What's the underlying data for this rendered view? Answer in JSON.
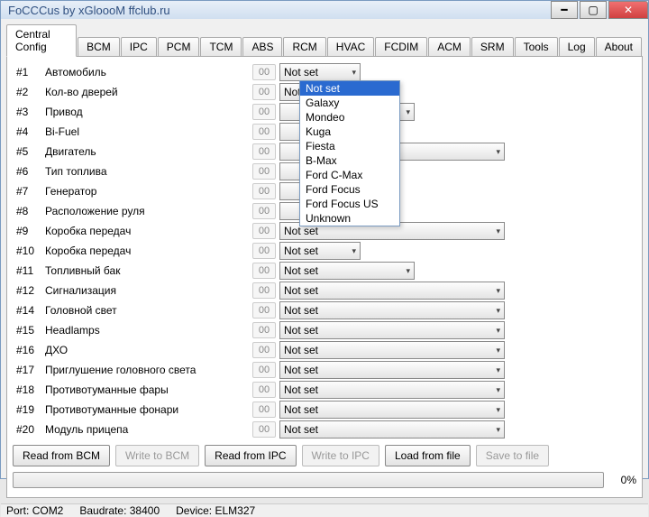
{
  "window": {
    "title": "FoCCCus by xGloooM ffclub.ru"
  },
  "tabs": [
    "Central Config",
    "BCM",
    "IPC",
    "PCM",
    "TCM",
    "ABS",
    "RCM",
    "HVAC",
    "FCDIM",
    "ACM",
    "SRM",
    "Tools",
    "Log",
    "About"
  ],
  "active_tab": 0,
  "params": [
    {
      "id": "#1",
      "label": "Автомобиль",
      "fid": "00",
      "value": "Not set",
      "width": "short",
      "open": true
    },
    {
      "id": "#2",
      "label": "Кол-во дверей",
      "fid": "00",
      "value": "Not set",
      "width": "short"
    },
    {
      "id": "#3",
      "label": "Привод",
      "fid": "00",
      "value": "",
      "width": "mid"
    },
    {
      "id": "#4",
      "label": "Bi-Fuel",
      "fid": "00",
      "value": "",
      "width": "short"
    },
    {
      "id": "#5",
      "label": "Двигатель",
      "fid": "00",
      "value": "",
      "width": "long"
    },
    {
      "id": "#6",
      "label": "Тип топлива",
      "fid": "00",
      "value": "",
      "width": "short"
    },
    {
      "id": "#7",
      "label": "Генератор",
      "fid": "00",
      "value": "",
      "width": "short"
    },
    {
      "id": "#8",
      "label": "Расположение руля",
      "fid": "00",
      "value": "",
      "width": "short"
    },
    {
      "id": "#9",
      "label": "Коробка передач",
      "fid": "00",
      "value": "Not set",
      "width": "long"
    },
    {
      "id": "#10",
      "label": "Коробка передач",
      "fid": "00",
      "value": "Not set",
      "width": "short"
    },
    {
      "id": "#11",
      "label": "Топливный бак",
      "fid": "00",
      "value": "Not set",
      "width": "mid"
    },
    {
      "id": "#12",
      "label": "Сигнализация",
      "fid": "00",
      "value": "Not set",
      "width": "long"
    },
    {
      "id": "#14",
      "label": "Головной свет",
      "fid": "00",
      "value": "Not set",
      "width": "long"
    },
    {
      "id": "#15",
      "label": "Headlamps",
      "fid": "00",
      "value": "Not set",
      "width": "long"
    },
    {
      "id": "#16",
      "label": "ДХО",
      "fid": "00",
      "value": "Not set",
      "width": "long"
    },
    {
      "id": "#17",
      "label": "Приглушение головного света",
      "fid": "00",
      "value": "Not set",
      "width": "long"
    },
    {
      "id": "#18",
      "label": "Противотуманные фары",
      "fid": "00",
      "value": "Not set",
      "width": "long"
    },
    {
      "id": "#19",
      "label": "Противотуманные фонари",
      "fid": "00",
      "value": "Not set",
      "width": "long"
    },
    {
      "id": "#20",
      "label": "Модуль прицепа",
      "fid": "00",
      "value": "Not set",
      "width": "long"
    }
  ],
  "dropdown_options": [
    "Not set",
    "Galaxy",
    "Mondeo",
    "Kuga",
    "Fiesta",
    "B-Max",
    "Ford C-Max",
    "Ford Focus",
    "Ford Focus US",
    "Unknown"
  ],
  "dropdown_selected_index": 0,
  "buttons": {
    "read_bcm": "Read from BCM",
    "write_bcm": "Write to BCM",
    "read_ipc": "Read from IPC",
    "write_ipc": "Write to IPC",
    "load_file": "Load from file",
    "save_file": "Save to file"
  },
  "progress": {
    "percent": "0%"
  },
  "status": {
    "port_label": "Port:",
    "port": "COM2",
    "baud_label": "Baudrate:",
    "baud": "38400",
    "device_label": "Device:",
    "device": "ELM327"
  }
}
